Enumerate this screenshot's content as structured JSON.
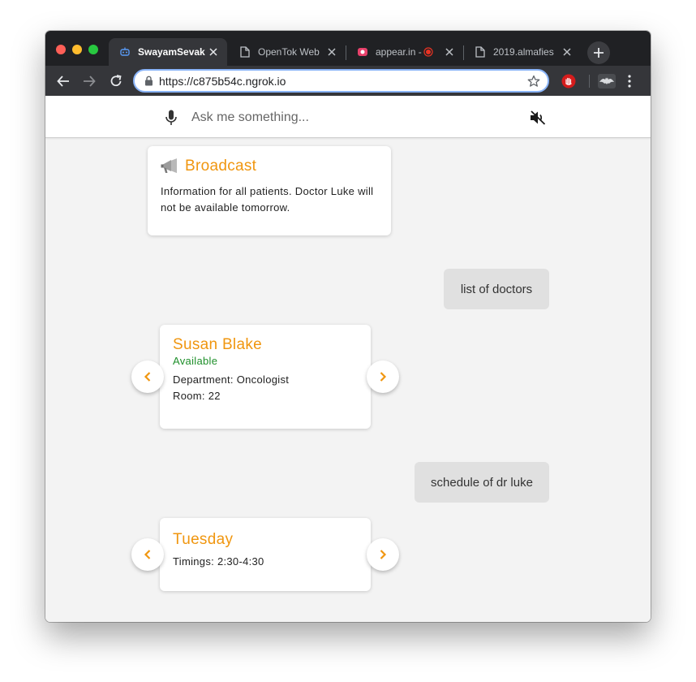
{
  "browser": {
    "tabs": [
      {
        "title": "SwayamSevak",
        "favicon": "robot-icon",
        "active": true
      },
      {
        "title": "OpenTok Web",
        "favicon": "page-icon",
        "active": false
      },
      {
        "title": "appear.in -",
        "favicon": "appear-in-icon",
        "active": false
      },
      {
        "title": "2019.almafies",
        "favicon": "page-icon",
        "active": false
      }
    ],
    "url": "https://c875b54c.ngrok.io"
  },
  "app": {
    "search_placeholder": "Ask me something...",
    "icons": {
      "mic": "microphone-icon",
      "mute": "volume-off-icon"
    },
    "accent_color": "#f0960f",
    "available_color": "#1e8f2a"
  },
  "chat": {
    "broadcast": {
      "title": "Broadcast",
      "text": "Information for all patients. Doctor Luke will not be available tomorrow."
    },
    "user_message_1": "list of doctors",
    "doctor_card": {
      "name": "Susan Blake",
      "status": "Available",
      "department": "Department: Oncologist",
      "room": "Room: 22"
    },
    "user_message_2": "schedule of dr luke",
    "schedule_card": {
      "day": "Tuesday",
      "timings": "Timings: 2:30-4:30"
    }
  }
}
